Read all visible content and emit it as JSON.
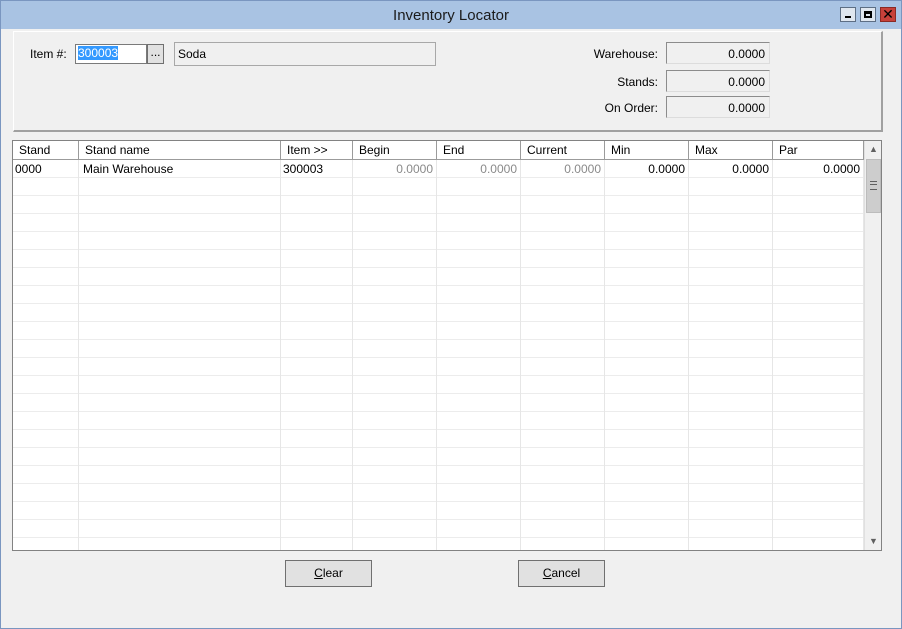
{
  "window": {
    "title": "Inventory Locator",
    "controls": [
      "minimize-icon",
      "maximize-icon",
      "close-icon"
    ]
  },
  "header": {
    "item_label": "Item #:",
    "item_value": "300003",
    "browse_label": "...",
    "description": "Soda",
    "warehouse_label": "Warehouse:",
    "warehouse_value": "0.0000",
    "stands_label": "Stands:",
    "stands_value": "0.0000",
    "onorder_label": "On Order:",
    "onorder_value": "0.0000"
  },
  "grid": {
    "columns": [
      "Stand",
      "Stand name",
      "Item >>",
      "Begin",
      "End",
      "Current",
      "Min",
      "Max",
      "Par"
    ],
    "rows": [
      [
        "0000",
        "Main Warehouse",
        "300003",
        "0.0000",
        "0.0000",
        "0.0000",
        "0.0000",
        "0.0000",
        "0.0000"
      ]
    ]
  },
  "buttons": {
    "clear": {
      "accel": "C",
      "rest": "lear"
    },
    "cancel": {
      "accel": "C",
      "rest": "ancel"
    }
  },
  "colors": {
    "titlebar": "#a9c3e3",
    "selection": "#3399ff",
    "close": "#c7413a"
  }
}
